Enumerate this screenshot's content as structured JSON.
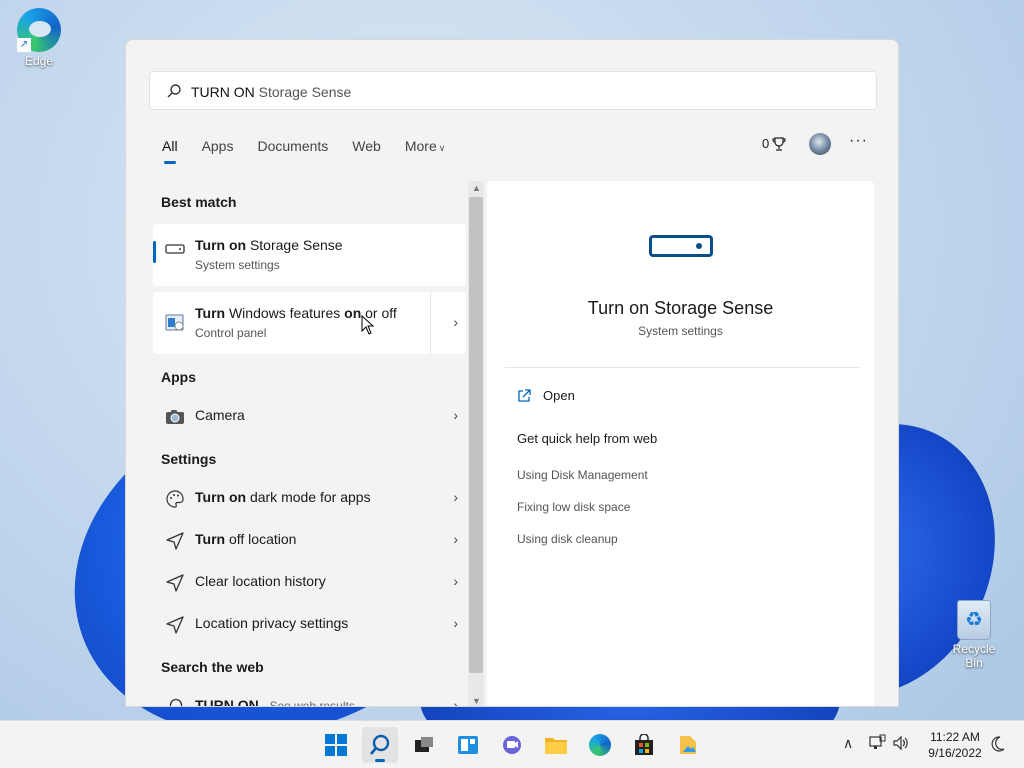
{
  "desktop": {
    "edge_label": "Edge",
    "recycle_label": "Recycle Bin"
  },
  "search": {
    "typed": "TURN ON",
    "hint": " Storage Sense"
  },
  "tabs": [
    {
      "label": "All",
      "active": true
    },
    {
      "label": "Apps"
    },
    {
      "label": "Documents"
    },
    {
      "label": "Web"
    },
    {
      "label": "More"
    }
  ],
  "rewards": {
    "points": "0"
  },
  "results": {
    "best_match_heading": "Best match",
    "best_match": {
      "bold": "Turn on",
      "rest": " Storage Sense",
      "sub": "System settings"
    },
    "second_match": {
      "bold1": "Turn",
      "mid": " Windows features ",
      "bold2": "on",
      "rest": " or off",
      "sub": "Control panel"
    },
    "apps_heading": "Apps",
    "apps": [
      {
        "label": "Camera"
      }
    ],
    "settings_heading": "Settings",
    "settings": [
      {
        "bold": "Turn on",
        "rest": " dark mode for apps"
      },
      {
        "bold": "Turn",
        "rest": " off location"
      },
      {
        "bold": "",
        "rest": "Clear location history"
      },
      {
        "bold": "",
        "rest": "Location privacy settings"
      }
    ],
    "web_heading": "Search the web",
    "web_item": {
      "bold": "TURN ON",
      "rest": " - See web results"
    }
  },
  "preview": {
    "title": "Turn on Storage Sense",
    "subtitle": "System settings",
    "open_label": "Open",
    "help_heading": "Get quick help from web",
    "links": [
      "Using Disk Management",
      "Fixing low disk space",
      "Using disk cleanup"
    ]
  },
  "taskbar": {
    "time": "11:22 AM",
    "date": "9/16/2022"
  },
  "colors": {
    "accent": "#0067c0",
    "preview_icon": "#0b4f8a"
  }
}
